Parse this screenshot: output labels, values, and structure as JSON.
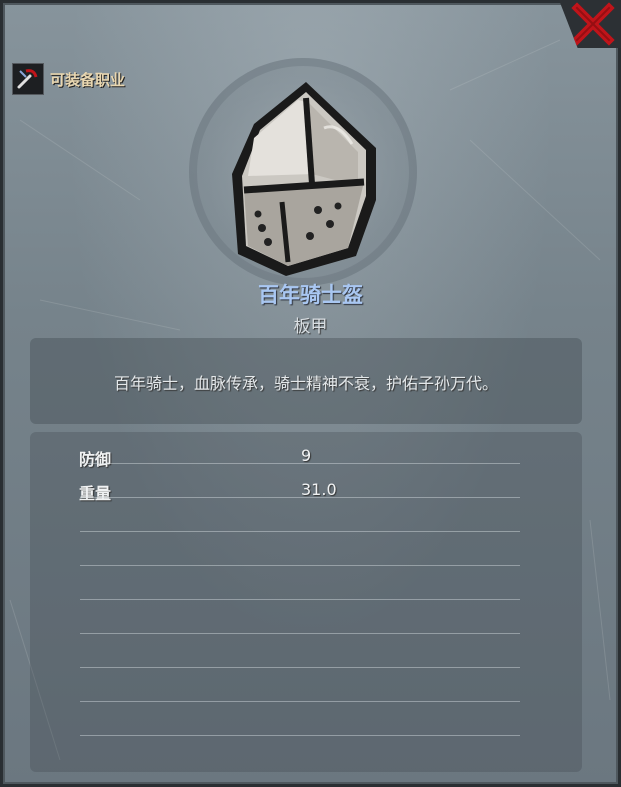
{
  "header": {
    "equip_class_label": "可装备职业"
  },
  "item": {
    "name": "百年骑士盔",
    "type": "板甲",
    "description": "百年骑士，血脉传承，骑士精神不衰，护佑子孙万代。"
  },
  "stats": [
    {
      "label": "防御",
      "value": "9"
    },
    {
      "label": "重量",
      "value": "31.0"
    }
  ],
  "colors": {
    "item_name": "#a9c7f2",
    "close_x": "#c0141a",
    "class_label": "#e8d6b0"
  },
  "icons": {
    "close": "close-x-icon",
    "class": "class-emblem-icon",
    "item": "knight-helmet-icon"
  }
}
